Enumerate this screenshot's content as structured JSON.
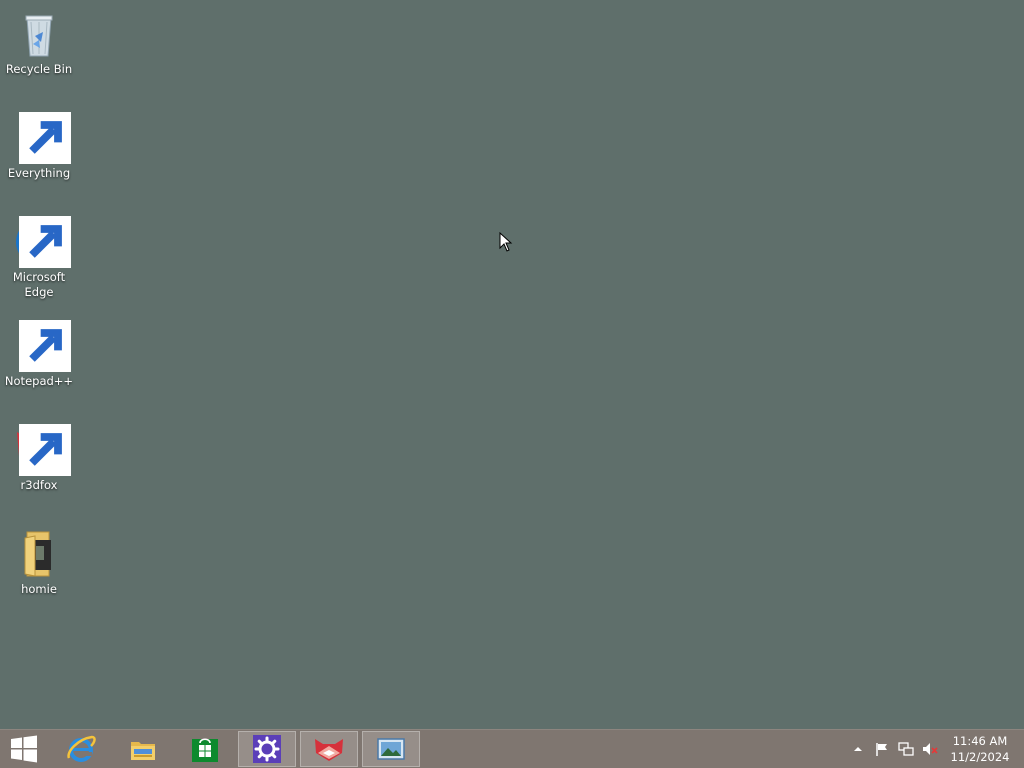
{
  "desktop": {
    "icons": [
      {
        "label": "Recycle Bin",
        "icon": "recycle-bin-icon"
      },
      {
        "label": "Everything",
        "icon": "everything-search-icon"
      },
      {
        "label": "Microsoft Edge",
        "icon": "edge-icon"
      },
      {
        "label": "Notepad++",
        "icon": "notepad-plus-plus-icon"
      },
      {
        "label": "r3dfox",
        "icon": "r3dfox-icon"
      },
      {
        "label": "homie",
        "icon": "folder-icon"
      }
    ],
    "background_color": "#5f6f6b"
  },
  "taskbar": {
    "background_color": "#7f7670",
    "pinned": [
      {
        "name": "internet-explorer",
        "icon": "internet-explorer-icon",
        "open": false
      },
      {
        "name": "file-explorer",
        "icon": "file-explorer-icon",
        "open": false
      },
      {
        "name": "store",
        "icon": "store-icon",
        "open": false
      },
      {
        "name": "settings",
        "icon": "settings-gear-icon",
        "open": true
      },
      {
        "name": "r3dfox",
        "icon": "r3dfox-icon",
        "open": true
      },
      {
        "name": "photos",
        "icon": "photo-viewer-icon",
        "open": true
      }
    ],
    "tray": {
      "icons": [
        "show-hidden-icons-chevron-icon",
        "action-center-flag-icon",
        "network-icon",
        "volume-muted-icon"
      ]
    },
    "clock": {
      "time": "11:46 AM",
      "date": "11/2/2024"
    }
  }
}
